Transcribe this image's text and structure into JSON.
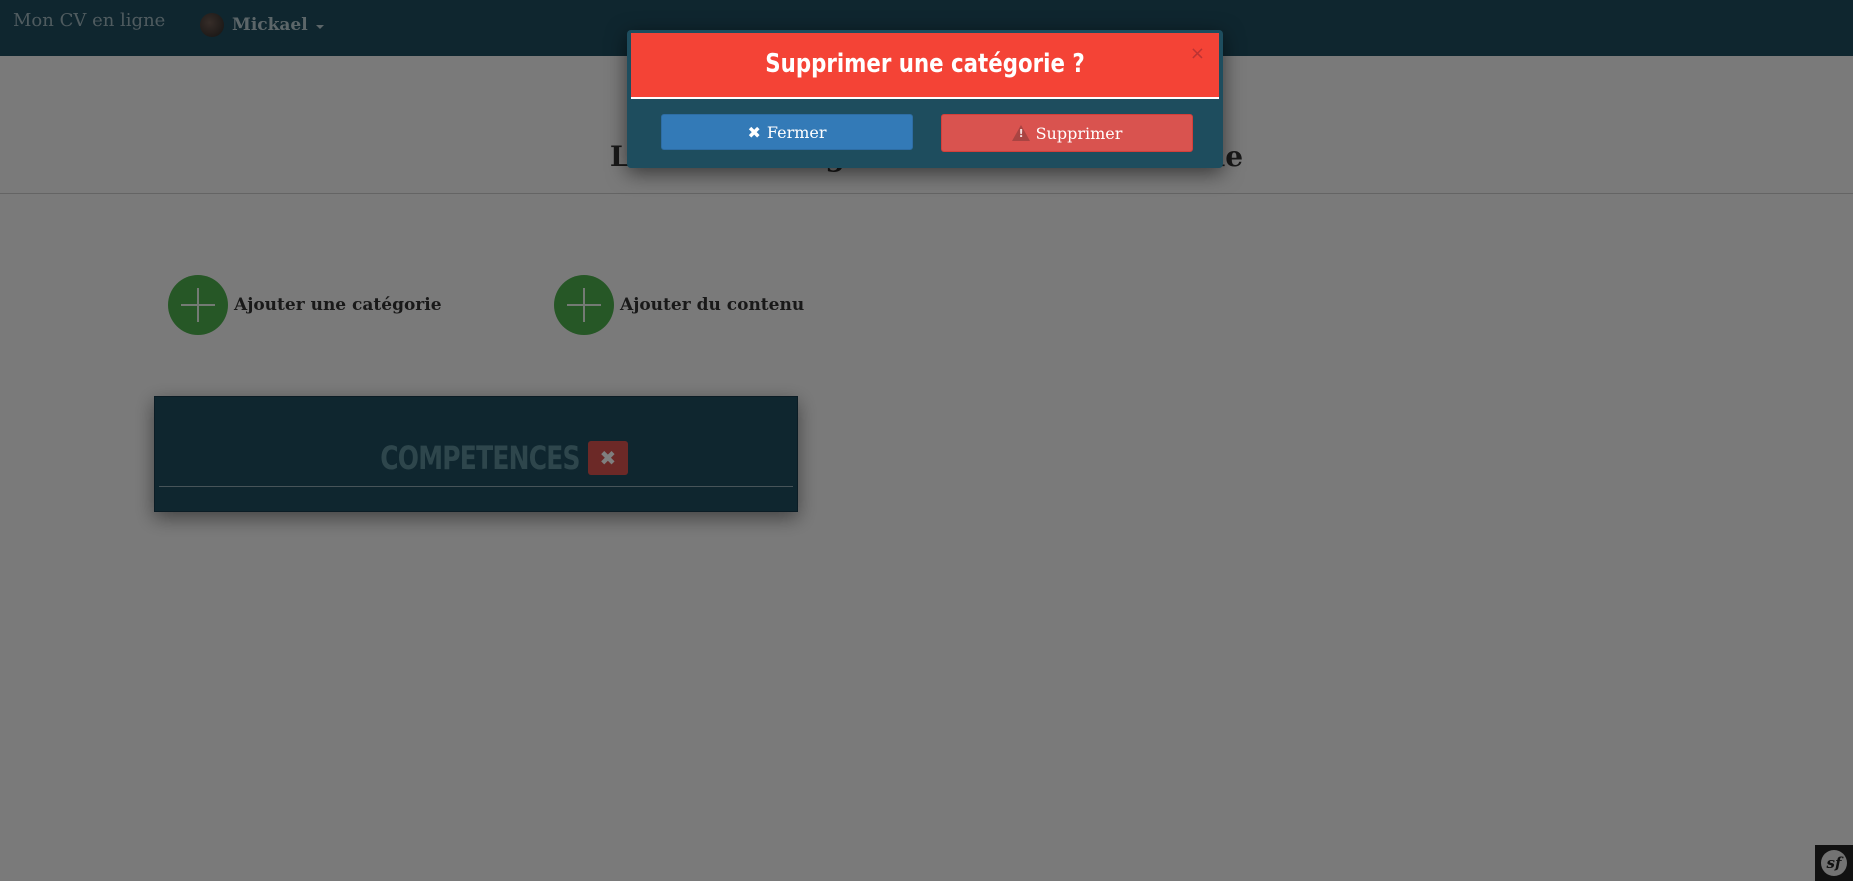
{
  "navbar": {
    "brand": "Mon CV en ligne",
    "user_name": "Mickael"
  },
  "page": {
    "title": "Liste des catégories du curriculum vitae",
    "add_category_label": "Ajouter une catégorie",
    "add_content_label": "Ajouter du contenu",
    "category_title": "COMPETENCES",
    "category_delete_glyph": "✖"
  },
  "modal": {
    "title": "Supprimer une catégorie ?",
    "close_glyph": "×",
    "close_button_label": "Fermer",
    "close_button_glyph": "✖",
    "delete_button_label": "Supprimer"
  },
  "toolbar": {
    "symfony_logo": "sf"
  },
  "colors": {
    "navbar": "#1e4d5e",
    "modal_header": "#f44336",
    "primary_button": "#337ab7",
    "danger_button": "#d9534f",
    "add_circle": "#4cae4c"
  }
}
